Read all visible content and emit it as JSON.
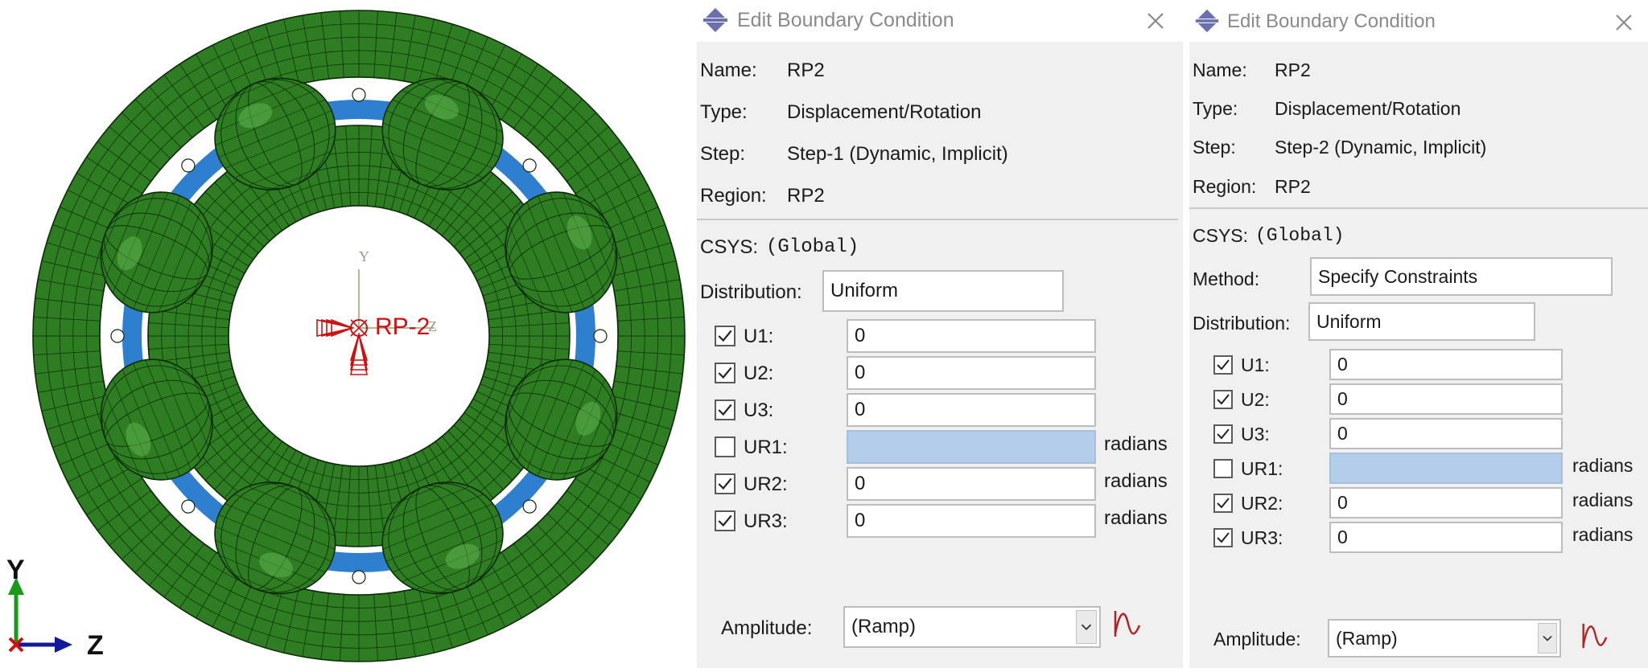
{
  "viewport": {
    "rp_label": "RP-2",
    "local_axis_y": "Y",
    "local_axis_z": "Z",
    "triad_y": "Y",
    "triad_z": "Z",
    "triad_x": "X",
    "colors": {
      "mesh": "#2e7d22",
      "mesh_light": "#5fb24f",
      "blue": "#2f7fd0",
      "rp": "#d01010",
      "triad_y": "#1a9a1a",
      "triad_z": "#101a9a",
      "triad_x": "#d01010"
    }
  },
  "dialogs": [
    {
      "title": "Edit Boundary Condition",
      "name_label": "Name:",
      "name_value": "RP2",
      "type_label": "Type:",
      "type_value": "Displacement/Rotation",
      "step_label": "Step:",
      "step_value": "Step-1 (Dynamic, Implicit)",
      "region_label": "Region:",
      "region_value": "RP2",
      "csys_label": "CSYS:",
      "csys_value": "(Global)",
      "distribution_label": "Distribution:",
      "distribution_value": "Uniform",
      "dofs": [
        {
          "label": "U1:",
          "checked": true,
          "value": "0",
          "unit": ""
        },
        {
          "label": "U2:",
          "checked": true,
          "value": "0",
          "unit": ""
        },
        {
          "label": "U3:",
          "checked": true,
          "value": "0",
          "unit": ""
        },
        {
          "label": "UR1:",
          "checked": false,
          "value": "",
          "unit": "radians"
        },
        {
          "label": "UR2:",
          "checked": true,
          "value": "0",
          "unit": "radians"
        },
        {
          "label": "UR3:",
          "checked": true,
          "value": "0",
          "unit": "radians"
        }
      ],
      "amplitude_label": "Amplitude:",
      "amplitude_value": "(Ramp)"
    },
    {
      "title": "Edit Boundary Condition",
      "name_label": "Name:",
      "name_value": "RP2",
      "type_label": "Type:",
      "type_value": "Displacement/Rotation",
      "step_label": "Step:",
      "step_value": "Step-2 (Dynamic, Implicit)",
      "region_label": "Region:",
      "region_value": "RP2",
      "csys_label": "CSYS:",
      "csys_value": "(Global)",
      "method_label": "Method:",
      "method_value": "Specify Constraints",
      "distribution_label": "Distribution:",
      "distribution_value": "Uniform",
      "dofs": [
        {
          "label": "U1:",
          "checked": true,
          "value": "0",
          "unit": ""
        },
        {
          "label": "U2:",
          "checked": true,
          "value": "0",
          "unit": ""
        },
        {
          "label": "U3:",
          "checked": true,
          "value": "0",
          "unit": ""
        },
        {
          "label": "UR1:",
          "checked": false,
          "value": "",
          "unit": "radians"
        },
        {
          "label": "UR2:",
          "checked": true,
          "value": "0",
          "unit": "radians"
        },
        {
          "label": "UR3:",
          "checked": true,
          "value": "0",
          "unit": "radians"
        }
      ],
      "amplitude_label": "Amplitude:",
      "amplitude_value": "(Ramp)"
    }
  ]
}
